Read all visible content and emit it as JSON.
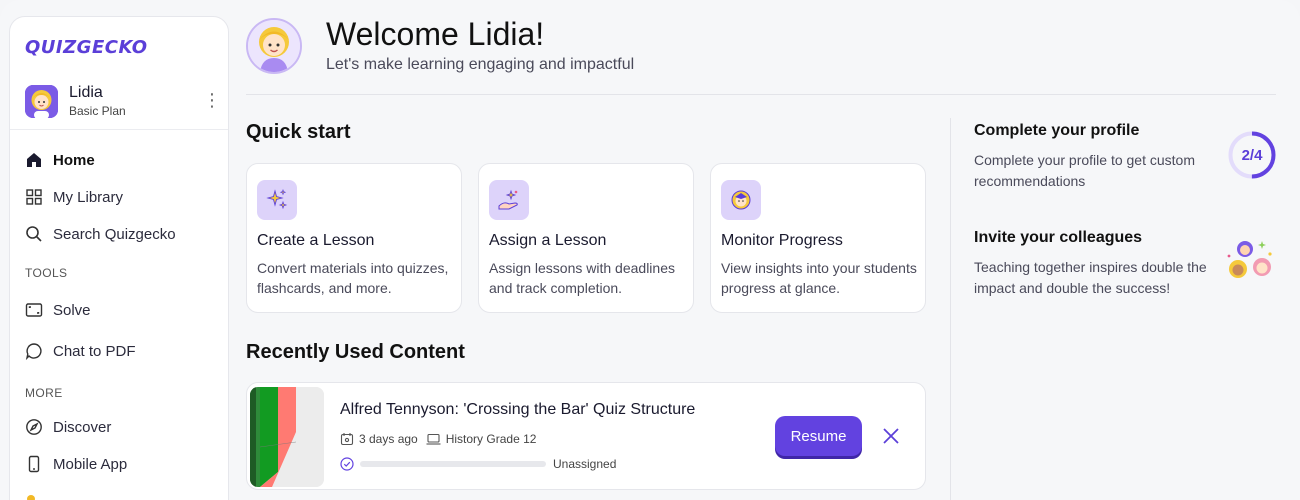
{
  "app": {
    "logo": "QUIZGECKO",
    "accent": "#6242e0"
  },
  "user": {
    "name": "Lidia",
    "plan": "Basic Plan",
    "menu_glyph": "⋮"
  },
  "sidebar": {
    "main_items": [
      {
        "label": "Home",
        "icon": "home-icon",
        "active": true
      },
      {
        "label": "My Library",
        "icon": "grid-icon"
      },
      {
        "label": "Search Quizgecko",
        "icon": "search-icon"
      }
    ],
    "tools_label": "TOOLS",
    "tools_items": [
      {
        "label": "Solve",
        "icon": "screen-crop-icon"
      },
      {
        "label": "Chat to PDF",
        "icon": "chat-icon"
      }
    ],
    "more_label": "MORE",
    "more_items": [
      {
        "label": "Discover",
        "icon": "compass-icon"
      },
      {
        "label": "Mobile App",
        "icon": "phone-icon"
      }
    ]
  },
  "header": {
    "welcome": "Welcome Lidia!",
    "subtitle": "Let's make learning engaging and impactful"
  },
  "quick_start": {
    "heading": "Quick start",
    "cards": [
      {
        "title": "Create a Lesson",
        "desc": "Convert materials into quizzes, flashcards, and more.",
        "icon": "sparkles-icon"
      },
      {
        "title": "Assign a Lesson",
        "desc": "Assign lessons with deadlines and track completion.",
        "icon": "hand-star-icon"
      },
      {
        "title": "Monitor Progress",
        "desc": "View insights into your students progress at glance.",
        "icon": "student-icon"
      }
    ]
  },
  "recent": {
    "heading": "Recently Used Content",
    "items": [
      {
        "title": "Alfred Tennyson: 'Crossing the Bar' Quiz Structure",
        "time": "3 days ago",
        "group": "History Grade 12",
        "status": "Unassigned",
        "progress": 0,
        "action": "Resume"
      }
    ]
  },
  "profile": {
    "title": "Complete your profile",
    "desc": "Complete your profile to get custom recommendations",
    "progress_label": "2/4",
    "progress_fraction": 0.5
  },
  "invite": {
    "title": "Invite your colleagues",
    "desc": "Teaching together inspires double the impact and double the success!"
  }
}
